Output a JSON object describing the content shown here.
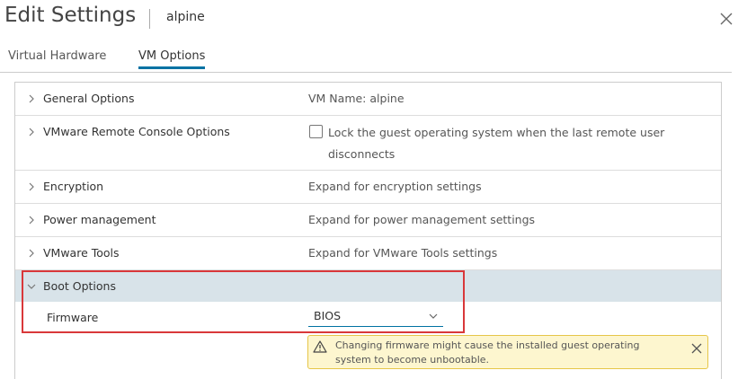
{
  "dialog": {
    "title": "Edit Settings",
    "vm_name": "alpine"
  },
  "tabs": [
    {
      "label": "Virtual Hardware",
      "active": false
    },
    {
      "label": "VM Options",
      "active": true
    }
  ],
  "rows": {
    "general": {
      "label": "General Options",
      "value": "VM Name: alpine"
    },
    "remote_console": {
      "label": "VMware Remote Console Options",
      "checkbox_label": "Lock the guest operating system when the last remote user disconnects",
      "checked": false
    },
    "encryption": {
      "label": "Encryption",
      "value": "Expand for encryption settings"
    },
    "power": {
      "label": "Power management",
      "value": "Expand for power management settings"
    },
    "tools": {
      "label": "VMware Tools",
      "value": "Expand for VMware Tools settings"
    },
    "boot": {
      "label": "Boot Options",
      "expanded": true
    }
  },
  "firmware": {
    "label": "Firmware",
    "selected": "BIOS"
  },
  "warning": {
    "text": "Changing firmware might cause the installed guest operating system to become unbootable."
  },
  "colors": {
    "accent": "#0072a3",
    "highlight_border": "#d9383a",
    "warning_bg": "#fdf6cf",
    "selected_row": "#d8e3e9"
  },
  "icons": [
    "close-icon",
    "chevron-right-icon",
    "chevron-down-icon",
    "warning-icon"
  ]
}
